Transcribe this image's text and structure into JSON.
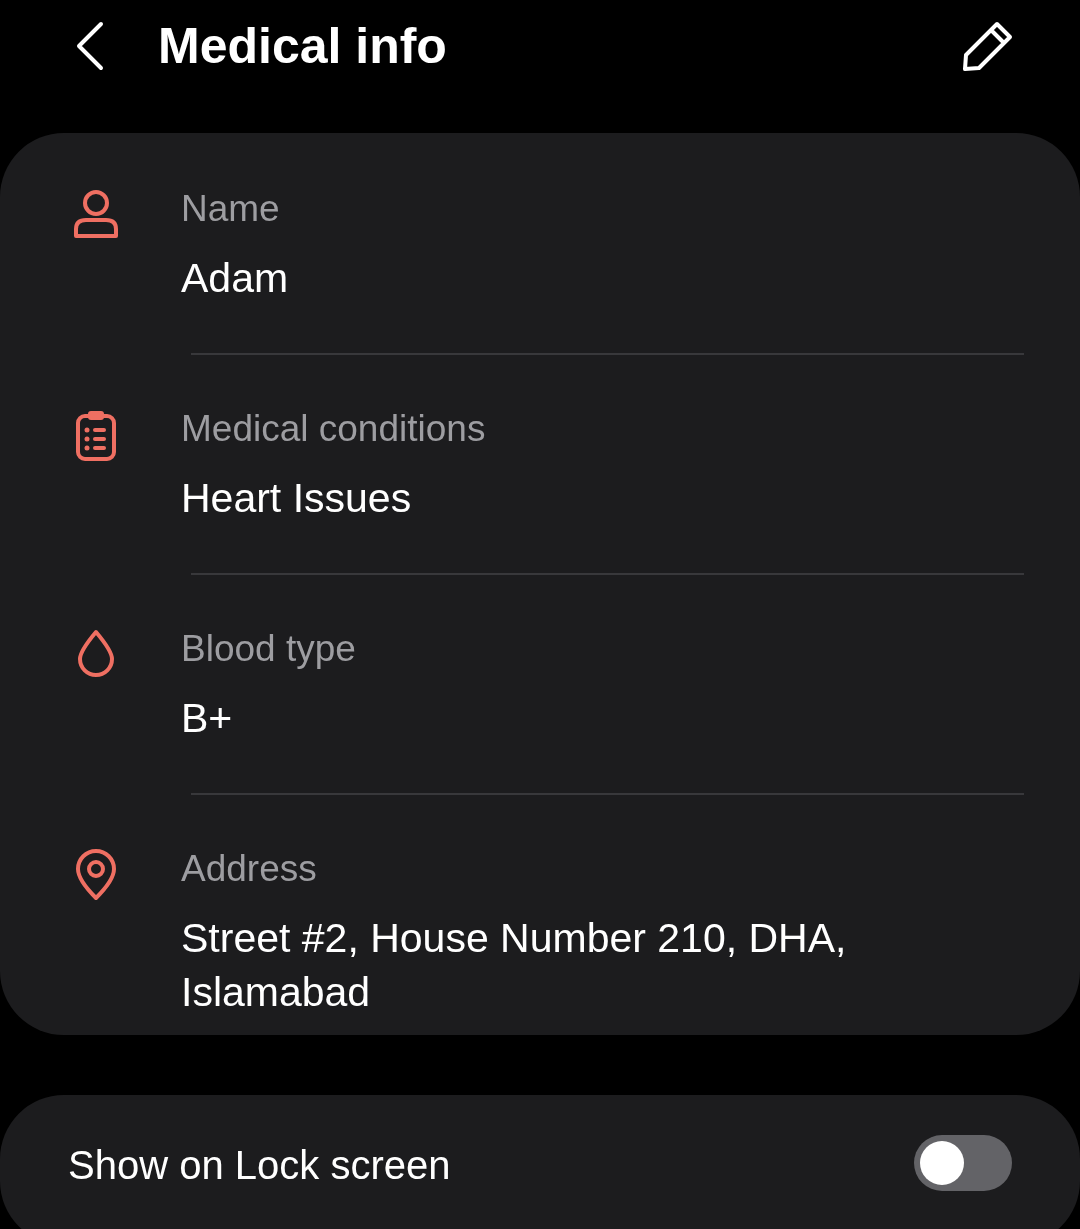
{
  "header": {
    "title": "Medical info"
  },
  "fields": [
    {
      "kind": "person",
      "label": "Name",
      "value": "Adam"
    },
    {
      "kind": "clipboard",
      "label": "Medical conditions",
      "value": "Heart Issues"
    },
    {
      "kind": "drop",
      "label": "Blood type",
      "value": "B+"
    },
    {
      "kind": "pin",
      "label": "Address",
      "value": "Street #2, House Number 210, DHA, Islamabad"
    }
  ],
  "lock_screen": {
    "label": "Show on Lock screen",
    "on": false
  }
}
